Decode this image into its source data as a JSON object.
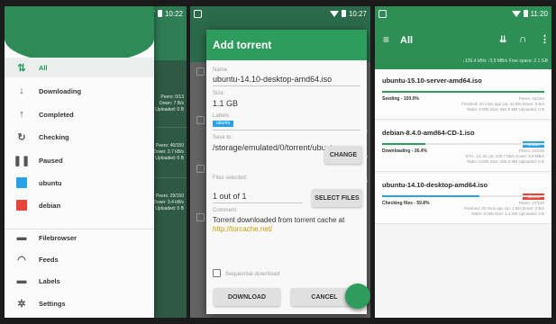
{
  "phone1": {
    "status_time": "10:22",
    "drawer_items": [
      {
        "icon": "arrows-updown-icon",
        "glyph": "⇅",
        "label": "All",
        "selected": true
      },
      {
        "icon": "download-icon",
        "glyph": "↓",
        "label": "Downloading",
        "selected": false
      },
      {
        "icon": "upload-icon",
        "glyph": "↑",
        "label": "Completed",
        "selected": false
      },
      {
        "icon": "refresh-icon",
        "glyph": "↻",
        "label": "Checking",
        "selected": false
      },
      {
        "icon": "pause-icon",
        "glyph": "❚❚",
        "label": "Paused",
        "selected": false
      },
      {
        "icon": "label-color-icon",
        "label": "ubuntu",
        "swatch": "#29a3e8"
      },
      {
        "icon": "label-color-icon",
        "label": "debian",
        "swatch": "#e4473a"
      },
      {
        "icon": "folder-icon",
        "glyph": "▬",
        "label": "Filebrowser"
      },
      {
        "icon": "rss-icon",
        "glyph": "◠",
        "label": "Feeds"
      },
      {
        "icon": "tag-icon",
        "glyph": "▬",
        "label": "Labels"
      },
      {
        "icon": "gear-icon",
        "glyph": "✲",
        "label": "Settings"
      }
    ]
  },
  "phone2": {
    "status_time": "10:27",
    "title": "Add torrent",
    "name_label": "Name:",
    "name_value": "ubuntu-14.10-desktop-amd64.iso",
    "size_label": "Size:",
    "size_value": "1.1 GB",
    "labels_label": "Labels:",
    "label_chip": "ubuntu",
    "save_label": "Save to:",
    "save_value": "/storage/emulated/0/torrent/ubuntu",
    "change_button": "CHANGE",
    "files_label": "Files selected:",
    "files_value": "1 out of 1",
    "select_files_button": "SELECT FILES",
    "comment_label": "Comment:",
    "comment_text": "Torrent downloaded from torrent cache at",
    "comment_link": "http://torcache.net/",
    "sequential_label": "Sequential download",
    "download_button": "DOWNLOAD",
    "cancel_button": "CANCEL",
    "accent": "#2e9c5c"
  },
  "phone3": {
    "status_time": "11:20",
    "title": "All",
    "speed_text": "↓126.4 kB/s ↑3.9 MB/s   Free space: 2.1 GB",
    "torrents": [
      {
        "name": "ubuntu-15.10-server-amd64.iso",
        "progress": 1.0,
        "bar_color": "#2e9c5c",
        "status": "Seeding - 100.0%",
        "meta": [
          "Peers: 42/154",
          "Finished: 20 mins ago   Up: 42 B/s   Down: 0 B/s",
          "Ratio: 0.000   Size: 652.0 MB   Uploaded: 0 B"
        ],
        "badge": "",
        "badge_color": ""
      },
      {
        "name": "debian-8.4.0-amd64-CD-1.iso",
        "progress": 0.264,
        "bar_color": "#2e9c5c",
        "status": "Downloading - 26.4%",
        "meta": [
          "Peers: 31/104",
          "ETA: 1m 4s   Up: 126.7 kB/s   Down: 3.9 MB/s",
          "Ratio: 0.000   Size: 630.0 MB   Uploaded: 0 B"
        ],
        "badge": "debian",
        "badge_color": "#29a3e8"
      },
      {
        "name": "ubuntu-14.10-desktop-amd64.iso",
        "progress": 0.598,
        "bar_color": "#29a3e8",
        "status": "Checking files - 59.8%",
        "meta": [
          "Peers: 27/120",
          "Finished: 20 mins ago   Up: 1 B/s   Down: 0 B/s",
          "Ratio: 0.000   Size: 1.1 GB   Uploaded: 0 B"
        ],
        "badge": "ubuntu",
        "badge_color": "#e4473a"
      }
    ]
  }
}
